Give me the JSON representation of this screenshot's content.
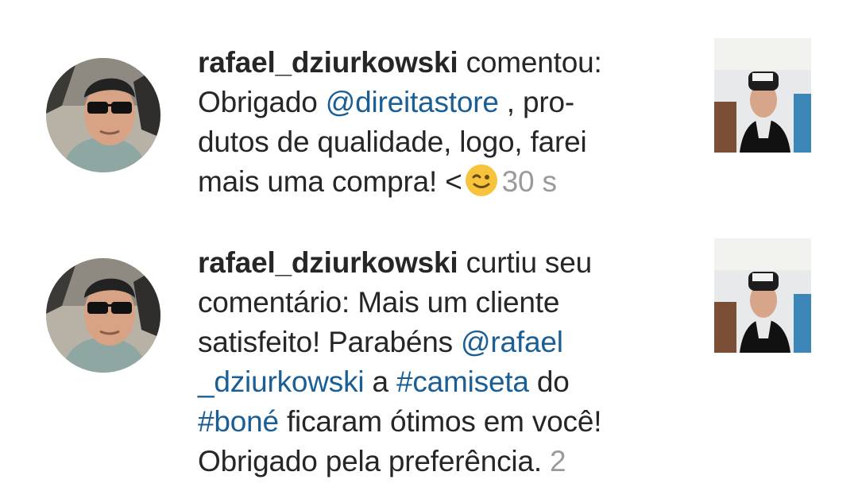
{
  "notifications": [
    {
      "username": "rafael_dziurkowski",
      "action": " comentou:",
      "lines": [
        [
          "Obrigado ",
          "@direitastore",
          " , pro-"
        ],
        [
          "dutos de qualidade, logo, farei"
        ],
        [
          "mais uma compra! <"
        ]
      ],
      "emoji_icon": "winking-face-icon",
      "timestamp": "30 s"
    },
    {
      "username": "rafael_dziurkowski",
      "action": " curtiu seu",
      "text_parts": {
        "l2": "comentário: Mais um cliente",
        "l3_a": "satisfeito! Parabéns ",
        "l3_mention": "@rafael",
        "l4_mention": "_dziurkowski",
        "l4_b": " a ",
        "l4_hashtag": "#camiseta",
        "l4_c": " do",
        "l5_hashtag": "#boné",
        "l5_b": " ficaram ótimos em você!",
        "l6_a": "Obrigado pela preferência. ",
        "l6_time": "2"
      }
    }
  ],
  "colors": {
    "text": "#262626",
    "link": "#1a5e96",
    "timestamp": "#9a9a9a",
    "background": "#ffffff"
  }
}
